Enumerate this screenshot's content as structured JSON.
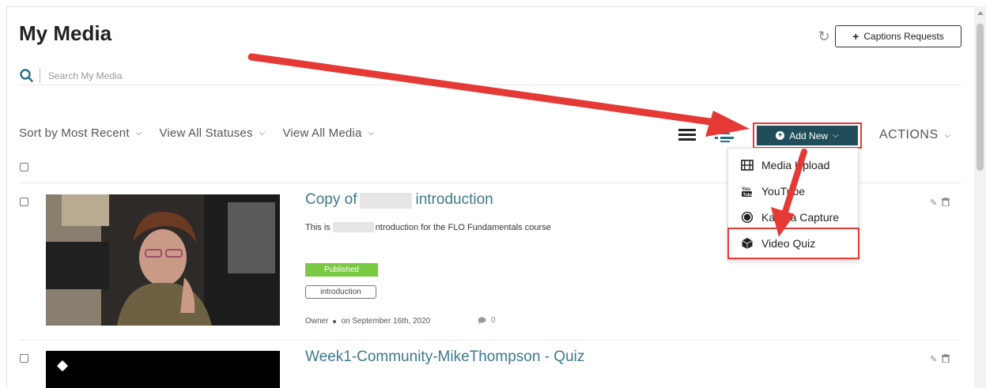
{
  "page": {
    "title": "My Media"
  },
  "toolbar": {
    "captions_label": "Captions Requests"
  },
  "search": {
    "placeholder": "Search My Media"
  },
  "filters": [
    {
      "label": "Sort by Most Recent"
    },
    {
      "label": "View All Statuses"
    },
    {
      "label": "View All Media"
    }
  ],
  "add_new": {
    "label": "Add New"
  },
  "actions": {
    "label": "ACTIONS"
  },
  "menu": {
    "items": [
      {
        "label": "Media Upload",
        "icon": "film-icon"
      },
      {
        "label": "YouTube",
        "icon": "youtube-icon"
      },
      {
        "label": "Kaltura Capture",
        "icon": "record-icon"
      },
      {
        "label": "Video Quiz",
        "icon": "cube-icon"
      }
    ]
  },
  "entries": [
    {
      "title_prefix": "Copy of",
      "title_suffix": "introduction",
      "desc_prefix": "This is",
      "desc_suffix": "ntroduction for the FLO Fundamentals course",
      "status": "Published",
      "tag": "introduction",
      "owner": "Owner",
      "date": "on September 16th, 2020",
      "comments": "0"
    },
    {
      "title": "Week1-Community-MikeThompson - Quiz"
    }
  ],
  "colors": {
    "accent": "#1f4e5a",
    "link": "#3d7a8c",
    "published": "#7ac943",
    "highlight": "#e53935"
  }
}
